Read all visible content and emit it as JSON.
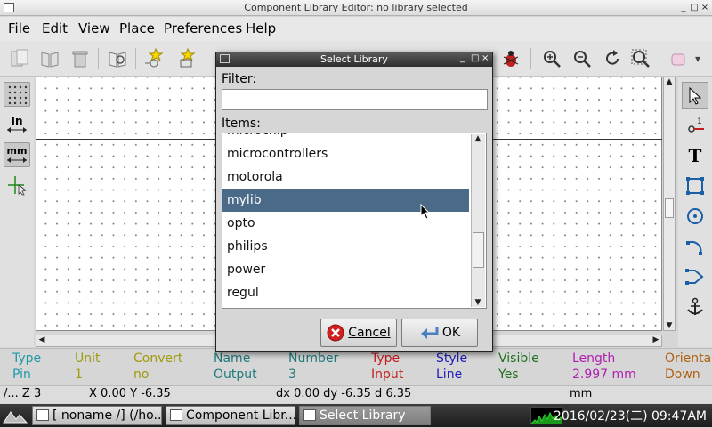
{
  "window": {
    "title": "Component Library Editor: no library selected",
    "controls": [
      "_",
      "□",
      "×"
    ]
  },
  "menubar": {
    "items": [
      "File",
      "Edit",
      "View",
      "Place",
      "Preferences",
      "Help"
    ]
  },
  "left_toolbar": {
    "inch_label": "In",
    "mm_label": "mm"
  },
  "right_toolbar": {
    "text_tool_label": "T"
  },
  "dialog": {
    "title": "Select Library",
    "filter_label": "Filter:",
    "filter_value": "",
    "items_label": "Items:",
    "items": [
      "microchip",
      "microcontrollers",
      "motorola",
      "mylib",
      "opto",
      "philips",
      "power",
      "regul"
    ],
    "selected_item": "mylib",
    "cancel_label": "Cancel",
    "ok_label": "OK"
  },
  "message_panel": {
    "fields": [
      {
        "label": "Type",
        "value": "Pin",
        "color": "#1f9aa8"
      },
      {
        "label": "Unit",
        "value": "1",
        "color": "#a09a10"
      },
      {
        "label": "Convert",
        "value": "no",
        "color": "#a09a10"
      },
      {
        "label": "Name",
        "value": "Output",
        "color": "#1f7a7a"
      },
      {
        "label": "Number",
        "value": "3",
        "color": "#1f7a7a"
      },
      {
        "label": "Type",
        "value": "Input",
        "color": "#c42020"
      },
      {
        "label": "Style",
        "value": "Line",
        "color": "#2020b8"
      },
      {
        "label": "Visible",
        "value": "Yes",
        "color": "#207020"
      },
      {
        "label": "Length",
        "value": "2.997 mm",
        "color": "#b020b0"
      },
      {
        "label": "Orienta",
        "value": "Down",
        "color": "#b06010"
      }
    ]
  },
  "statusbar": {
    "zoom": "/... Z 3",
    "cursor": "X 0.00  Y -6.35",
    "delta": "dx 0.00  dy -6.35  d 6.35",
    "units": "mm"
  },
  "taskbar": {
    "tasks": [
      "[ noname /] (/ho...",
      "Component Libr...",
      "Select Library"
    ],
    "active_task": "Select Library",
    "clock": "2016/02/23(二) 09:47AM"
  }
}
